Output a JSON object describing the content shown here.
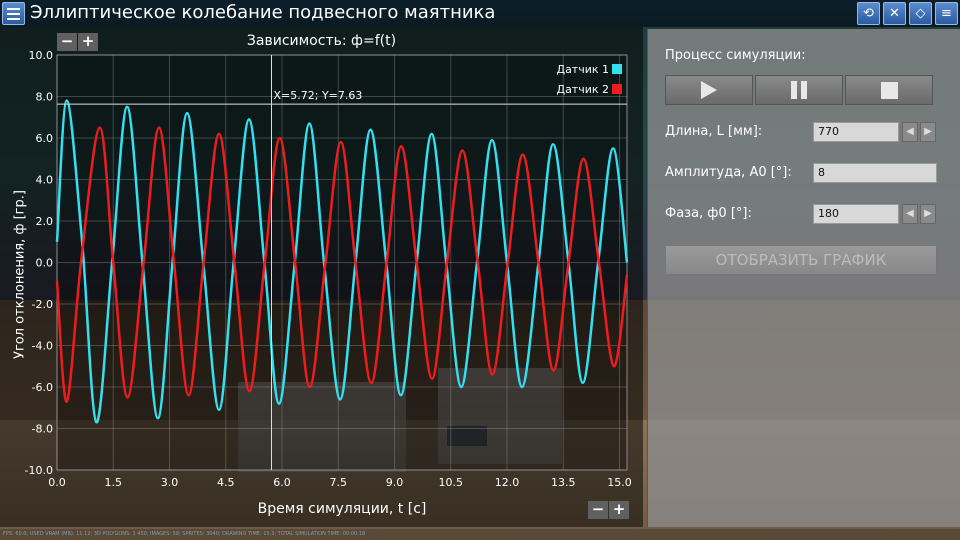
{
  "app": {
    "title": "Эллиптическое колебание подвесного маятника"
  },
  "toolbar": {
    "icons": [
      "refresh-icon",
      "mute-icon",
      "eraser-icon",
      "list-icon"
    ]
  },
  "chart": {
    "zoom_minus": "−",
    "zoom_plus": "+",
    "cursor_readout": "X=5.72; Y=7.63"
  },
  "chart_data": {
    "type": "line",
    "title": "Зависимость: ф=f(t)",
    "xlabel": "Время симуляции, t [с]",
    "ylabel": "Угол отклонения, ф [гр.]",
    "xlim": [
      0,
      15.2
    ],
    "ylim": [
      -10,
      10
    ],
    "xticks": [
      "0.0",
      "1.5",
      "3.0",
      "4.5",
      "6.0",
      "7.5",
      "9.0",
      "10.5",
      "12.0",
      "13.5",
      "15.0"
    ],
    "yticks": [
      "10.0",
      "8.0",
      "6.0",
      "4.0",
      "2.0",
      "0.0",
      "-2.0",
      "-4.0",
      "-6.0",
      "-8.0",
      "-10.0"
    ],
    "grid": true,
    "legend": "top-right",
    "cursor": {
      "x": 5.72,
      "y": 7.63
    },
    "series": [
      {
        "name": "Датчик 1",
        "color": "#33e0f0",
        "points": [
          [
            0.0,
            1.0
          ],
          [
            0.26,
            7.8
          ],
          [
            0.67,
            1.0
          ],
          [
            1.05,
            -7.7
          ],
          [
            1.47,
            0.0
          ],
          [
            1.87,
            7.5
          ],
          [
            2.28,
            0.0
          ],
          [
            2.69,
            -7.5
          ],
          [
            3.08,
            0.0
          ],
          [
            3.47,
            7.2
          ],
          [
            3.9,
            0.0
          ],
          [
            4.32,
            -7.1
          ],
          [
            4.71,
            0.0
          ],
          [
            5.12,
            6.9
          ],
          [
            5.53,
            0.0
          ],
          [
            5.92,
            -6.8
          ],
          [
            6.34,
            0.0
          ],
          [
            6.73,
            6.7
          ],
          [
            7.12,
            0.0
          ],
          [
            7.55,
            -6.6
          ],
          [
            7.96,
            0.0
          ],
          [
            8.36,
            6.4
          ],
          [
            8.78,
            0.0
          ],
          [
            9.17,
            -6.4
          ],
          [
            9.59,
            0.0
          ],
          [
            9.99,
            6.2
          ],
          [
            10.38,
            0.0
          ],
          [
            10.78,
            -6.0
          ],
          [
            11.2,
            0.0
          ],
          [
            11.6,
            5.9
          ],
          [
            12.0,
            0.0
          ],
          [
            12.4,
            -6.0
          ],
          [
            12.84,
            0.0
          ],
          [
            13.23,
            5.7
          ],
          [
            13.64,
            0.0
          ],
          [
            14.02,
            -5.8
          ],
          [
            14.43,
            0.0
          ],
          [
            14.83,
            5.5
          ],
          [
            15.2,
            0.0
          ]
        ]
      },
      {
        "name": "Датчик 2",
        "color": "#ee1c1c",
        "points": [
          [
            0.0,
            -0.9
          ],
          [
            0.26,
            -6.7
          ],
          [
            0.64,
            0.0
          ],
          [
            1.14,
            6.5
          ],
          [
            1.5,
            0.0
          ],
          [
            1.88,
            -6.5
          ],
          [
            2.31,
            0.0
          ],
          [
            2.72,
            6.5
          ],
          [
            3.12,
            0.0
          ],
          [
            3.51,
            -6.4
          ],
          [
            3.91,
            0.0
          ],
          [
            4.32,
            6.2
          ],
          [
            4.73,
            0.0
          ],
          [
            5.13,
            -6.2
          ],
          [
            5.54,
            0.0
          ],
          [
            5.94,
            6.0
          ],
          [
            6.35,
            0.0
          ],
          [
            6.74,
            -6.0
          ],
          [
            7.16,
            0.0
          ],
          [
            7.57,
            5.8
          ],
          [
            7.96,
            0.0
          ],
          [
            8.38,
            -5.8
          ],
          [
            8.79,
            0.0
          ],
          [
            9.18,
            5.6
          ],
          [
            9.59,
            0.0
          ],
          [
            10.0,
            -5.6
          ],
          [
            10.4,
            0.0
          ],
          [
            10.81,
            5.4
          ],
          [
            11.22,
            0.0
          ],
          [
            11.61,
            -5.4
          ],
          [
            12.02,
            0.0
          ],
          [
            12.42,
            5.2
          ],
          [
            12.84,
            0.0
          ],
          [
            13.24,
            -5.2
          ],
          [
            13.64,
            0.0
          ],
          [
            14.04,
            5.0
          ],
          [
            14.45,
            0.0
          ],
          [
            14.85,
            -5.0
          ],
          [
            15.2,
            -0.6
          ]
        ]
      }
    ]
  },
  "side": {
    "process_label": "Процесс симуляции:",
    "length_label": "Длина, L [мм]:",
    "length_value": "770",
    "amplitude_label": "Амплитуда, А0 [°]:",
    "amplitude_value": "8",
    "phase_label": "Фаза, ф0 [°]:",
    "phase_value": "180",
    "stepper_left": "◀",
    "stepper_right": "▶",
    "plot_button": "ОТОБРАЗИТЬ ГРАФИК"
  },
  "status": {
    "text": "FPS: 60.0; USED VRAM (MB): 11.12; 3D POLYGONS: 1 450; IMAGES: 58; SPRITES: 3040; DRAWING TIME: 15.3; TOTAL SIMULATION TIME: 00:00:18"
  }
}
